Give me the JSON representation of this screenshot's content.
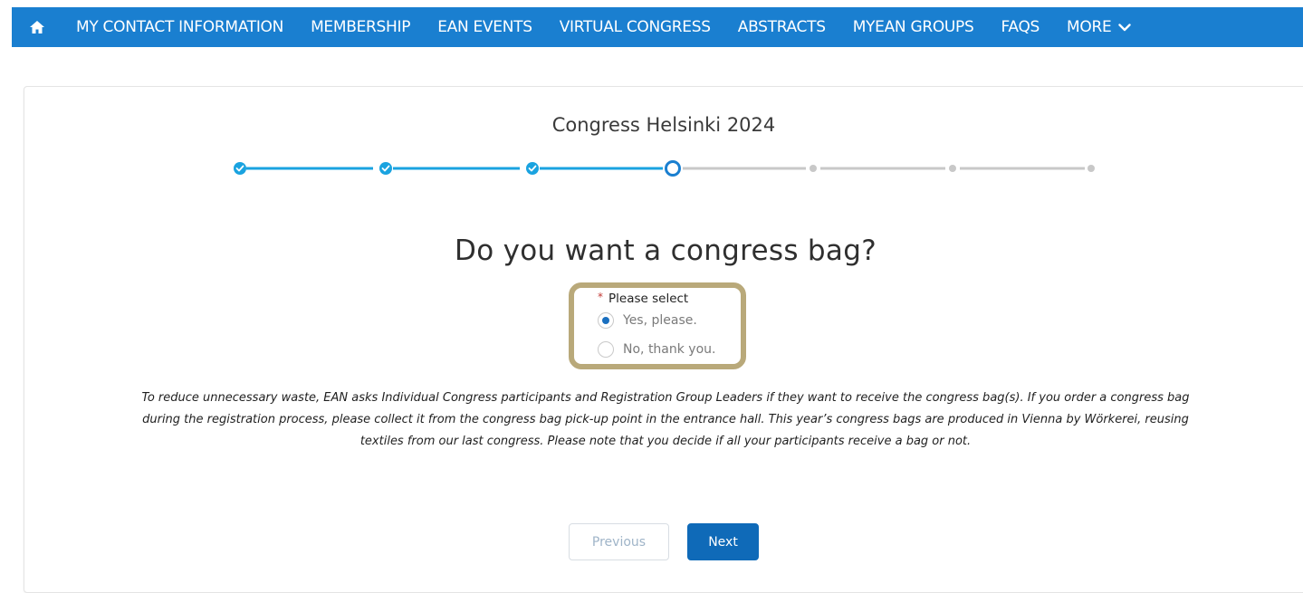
{
  "nav": {
    "home_icon": "home-icon",
    "items": [
      "MY CONTACT INFORMATION",
      "MEMBERSHIP",
      "EAN EVENTS",
      "VIRTUAL CONGRESS",
      "ABSTRACTS",
      "MYEAN GROUPS",
      "FAQS"
    ],
    "more_label": "MORE",
    "more_icon": "chevron-down-icon",
    "bar_color": "#1a7fd0"
  },
  "page": {
    "congress_title": "Congress Helsinki 2024",
    "stepper": {
      "total_steps": 7,
      "completed_steps": 3,
      "current_step": 4,
      "active_color": "#1aa3e0",
      "inactive_color": "#c8c8c8"
    },
    "question": "Do you want a congress bag?",
    "select_label": "Please select",
    "required_marker": "*",
    "options": [
      {
        "label": "Yes, please.",
        "selected": true
      },
      {
        "label": "No, thank you.",
        "selected": false
      }
    ],
    "info_lines": [
      "To reduce unnecessary waste, EAN asks Individual Congress participants and Registration Group Leaders if they want to receive the congress bag(s). If you order a congress bag",
      "during the registration process, please collect it from the congress bag pick-up point in the entrance hall. This year’s congress bags are produced in Vienna by Wörkerei, reusing",
      "textiles from our last congress. Please note that you decide if all your participants receive a bag or not."
    ],
    "buttons": {
      "previous": "Previous",
      "next": "Next"
    }
  }
}
